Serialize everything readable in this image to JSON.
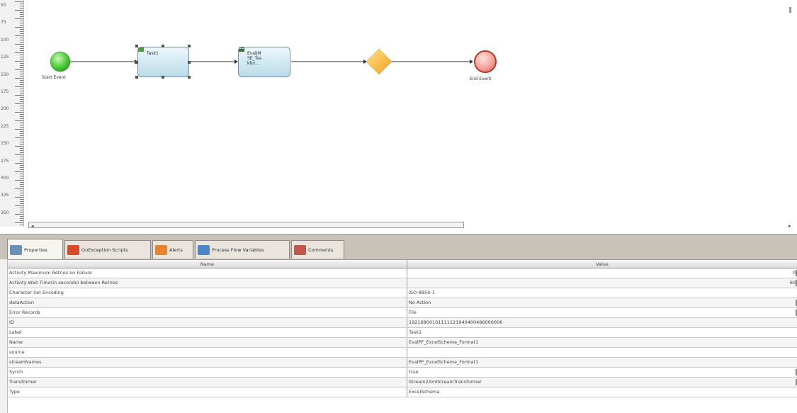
{
  "ruler": {
    "labels": [
      "50",
      "75",
      "100",
      "125",
      "150",
      "175",
      "200",
      "225",
      "250",
      "275",
      "300",
      "325",
      "350"
    ]
  },
  "flow": {
    "start_event_label": "Start Event",
    "end_event_label": "End Event",
    "task1_label": "Task1",
    "task2_label_line1": "EvalJM",
    "task2_label_line2": "SE_Tas",
    "task2_label_line3": "kbo..."
  },
  "tabs": [
    {
      "label": "Properties",
      "icon": "properties-icon",
      "color": "#6b8fb5"
    },
    {
      "label": "OnException Scripts",
      "icon": "no-entry-icon",
      "color": "#d94a2b"
    },
    {
      "label": "Alerts",
      "icon": "alert-icon",
      "color": "#e8842a"
    },
    {
      "label": "Process Flow Variables",
      "icon": "variables-icon",
      "color": "#4a86c8"
    },
    {
      "label": "Comments",
      "icon": "comments-icon",
      "color": "#c0584a"
    }
  ],
  "grid": {
    "header_name": "Name",
    "header_value": "Value",
    "rows": [
      {
        "name": "Activity Maximum Retries on Failure",
        "value": "",
        "right": "0"
      },
      {
        "name": "Activity Wait Time(in seconds) between Retries",
        "value": "",
        "right": "60"
      },
      {
        "name": "Character Set Encoding",
        "value": "ISO-8859-1",
        "right": ""
      },
      {
        "name": "dataAction",
        "value": "No Action",
        "right": ""
      },
      {
        "name": "Error Records",
        "value": "File",
        "right": ""
      },
      {
        "name": "ID",
        "value": "19216800101111121940400486000006",
        "right": ""
      },
      {
        "name": "Label",
        "value": "Task1",
        "right": ""
      },
      {
        "name": "Name",
        "value": "EvalPF_ExcelSchema_Format1",
        "right": ""
      },
      {
        "name": "source",
        "value": "",
        "right": ""
      },
      {
        "name": "streamNames",
        "value": "EvalPF_ExcelSchema_Format1",
        "right": ""
      },
      {
        "name": "Synch",
        "value": "true",
        "right": ""
      },
      {
        "name": "Transformer",
        "value": "Stream2XmlStreamTransformer",
        "right": ""
      },
      {
        "name": "Type",
        "value": "ExcelSchema",
        "right": ""
      }
    ]
  }
}
